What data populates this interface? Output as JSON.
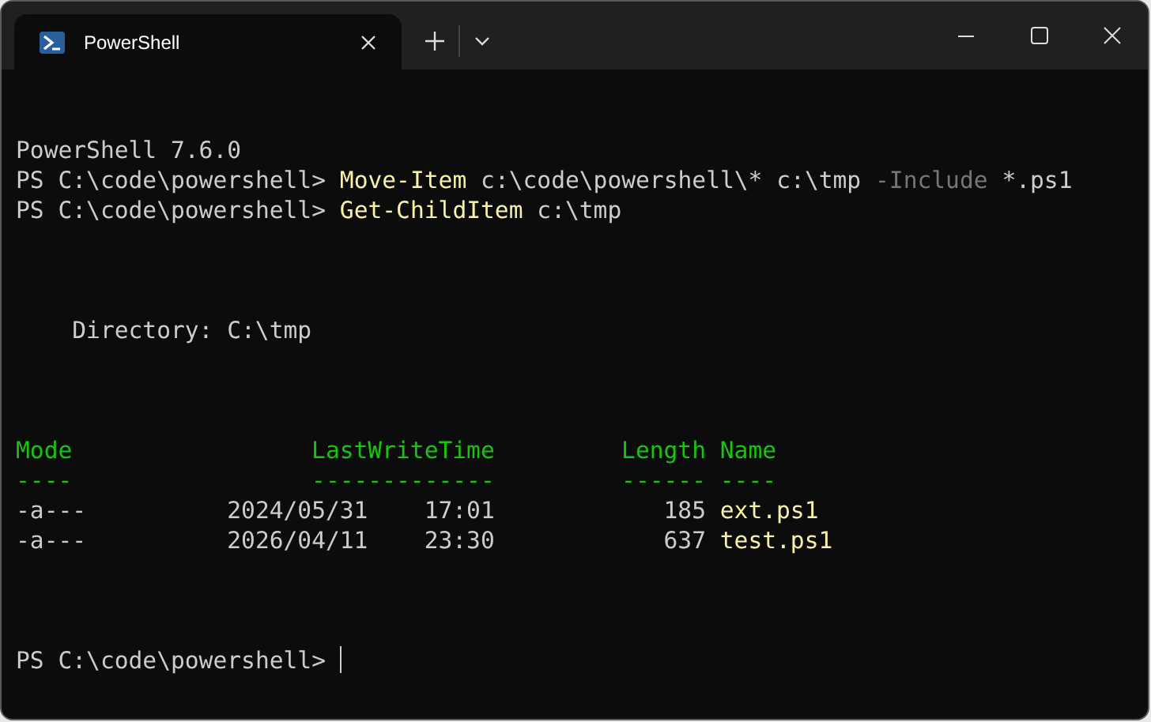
{
  "window": {
    "tab": {
      "title": "PowerShell",
      "selected": true
    }
  },
  "terminal": {
    "lines": [
      {
        "segments": [
          {
            "kind": "output",
            "text": "PowerShell 7.6.0"
          }
        ]
      },
      {
        "segments": [
          {
            "kind": "prompt",
            "text": "PS C:\\code\\powershell>"
          },
          {
            "kind": "command",
            "text": "Move-Item"
          },
          {
            "kind": "argument",
            "text": "c:\\code\\powershell\\*"
          },
          {
            "kind": "argument",
            "text": "c:\\tmp"
          },
          {
            "kind": "parameter",
            "text": "-Include"
          },
          {
            "kind": "argument",
            "text": "*.ps1"
          }
        ]
      },
      {
        "segments": [
          {
            "kind": "prompt",
            "text": "PS C:\\code\\powershell>"
          },
          {
            "kind": "command",
            "text": "Get-ChildItem"
          },
          {
            "kind": "argument",
            "text": "c:\\tmp"
          }
        ]
      }
    ],
    "directory_label": "Directory: C:\\tmp",
    "table": {
      "columns": [
        {
          "label": "Mode",
          "underline": "----"
        },
        {
          "label": "LastWriteTime",
          "underline": "-------------"
        },
        {
          "label": "Length",
          "underline": "------"
        },
        {
          "label": "Name",
          "underline": "----"
        }
      ],
      "rows": [
        {
          "mode": "-a---",
          "date": "2024/05/31",
          "time": "17:01",
          "length": "185",
          "name": "ext.ps1"
        },
        {
          "mode": "-a---",
          "date": "2026/04/11",
          "time": "23:30",
          "length": "637",
          "name": "test.ps1"
        }
      ]
    },
    "prompt": {
      "text": "PS C:\\code\\powershell>",
      "cursor": true
    }
  }
}
